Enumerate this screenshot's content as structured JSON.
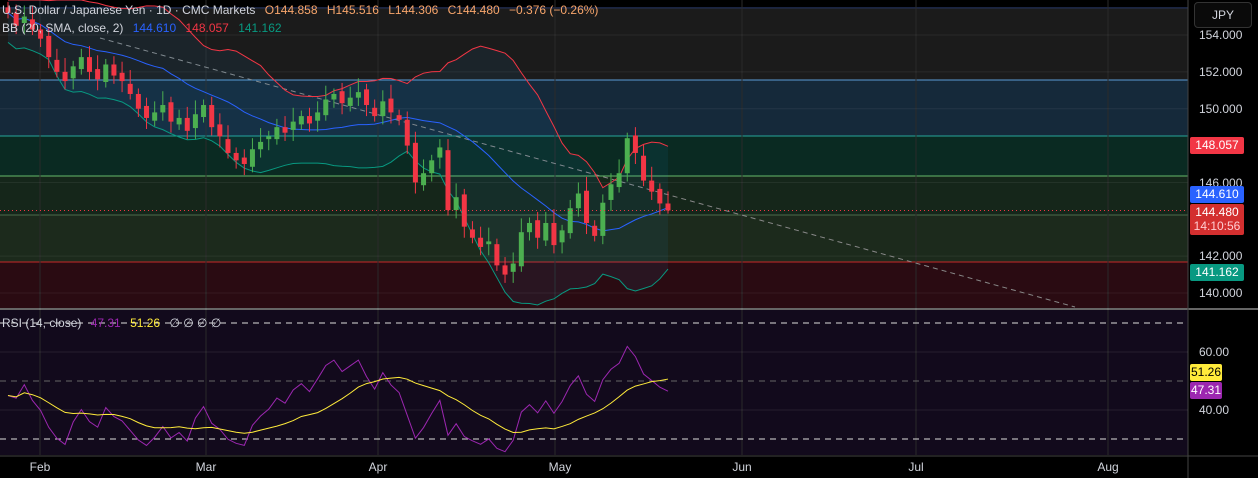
{
  "header": {
    "symbol": "U.S. Dollar / Japanese Yen · 1D · CMC Markets",
    "o": "O144.858",
    "h": "H145.516",
    "l": "L144.306",
    "c": "C144.480",
    "chg": "−0.376 (−0.26%)"
  },
  "bb_legend": {
    "label": "BB (20, SMA, close, 2)",
    "basis": "144.610",
    "upper": "148.057",
    "lower": "141.162"
  },
  "rsi_legend": {
    "label": "RSI (14, close)",
    "rsi": "47.31",
    "ma": "51.26",
    "extra": "∅ ∅ ∅ ∅"
  },
  "axis": {
    "currency": "JPY",
    "price_ticks": [
      "154.000",
      "152.000",
      "150.000",
      "146.000",
      "142.000",
      "140.000"
    ],
    "rsi_ticks": [
      "60.00",
      "40.00"
    ],
    "months": [
      "Feb",
      "Mar",
      "Apr",
      "May",
      "Jun",
      "Jul",
      "Aug"
    ]
  },
  "tags": {
    "upper": "148.057",
    "basis": "144.610",
    "last": "144.480",
    "countdown": "14:10:56",
    "lower": "141.162",
    "rsi_ma": "51.26",
    "rsi": "47.31"
  },
  "colors": {
    "up": "#26a69a",
    "upGreen": "#4caf50",
    "down": "#f23645",
    "basis": "#2962ff",
    "upper": "#f23645",
    "lower": "#089981",
    "rsi": "#9c27b0",
    "rsi_ma": "#ffeb3b"
  },
  "chart_data": {
    "type": "candlestick",
    "title": "U.S. Dollar / Japanese Yen · 1D · CMC Markets",
    "ylim": [
      139,
      156.5
    ],
    "rsi_ylim": [
      20,
      80
    ],
    "zones": [
      155.47,
      151.56,
      148.52,
      146.35,
      144.23,
      141.68
    ],
    "closes": [
      155.2,
      154.5,
      155.0,
      154.3,
      153.8,
      152.8,
      152.0,
      151.5,
      152.3,
      152.8,
      152.0,
      151.6,
      152.4,
      151.8,
      151.5,
      150.8,
      150.0,
      149.5,
      149.8,
      150.2,
      149.3,
      149.5,
      148.8,
      149.7,
      150.2,
      149.0,
      148.5,
      147.6,
      147.2,
      147.0,
      147.8,
      148.2,
      148.5,
      149.0,
      148.7,
      149.3,
      149.6,
      149.2,
      149.8,
      150.5,
      150.8,
      150.3,
      150.6,
      150.9,
      150.2,
      149.6,
      150.4,
      149.8,
      149.4,
      148.0,
      146.0,
      146.5,
      147.2,
      147.9,
      144.5,
      145.2,
      143.6,
      143.0,
      142.5,
      142.8,
      141.5,
      141.0,
      141.6,
      143.3,
      143.8,
      143.0,
      143.8,
      142.6,
      143.4,
      144.6,
      145.4,
      143.8,
      143.1,
      144.9,
      145.9,
      146.5,
      148.4,
      147.6,
      146.1,
      145.5,
      144.86,
      144.48
    ],
    "last": {
      "open": 144.858,
      "high": 145.516,
      "low": 144.306,
      "close": 144.48
    }
  }
}
